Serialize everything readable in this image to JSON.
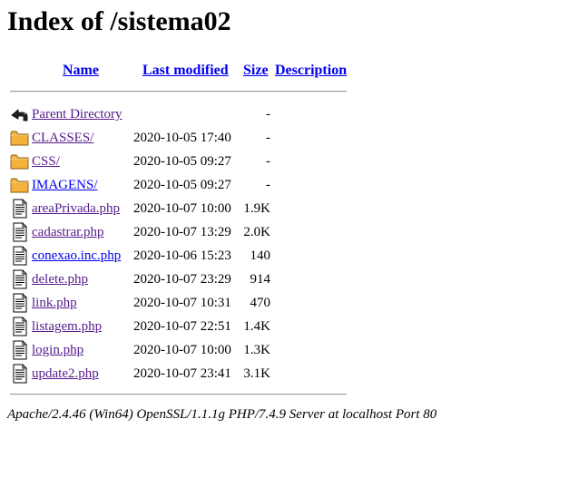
{
  "title": "Index of /sistema02",
  "columns": {
    "name": "Name",
    "last_modified": "Last modified",
    "size": "Size",
    "description": "Description"
  },
  "parent": {
    "label": "Parent Directory",
    "size": "-",
    "icon": "back-arrow-icon"
  },
  "entries": [
    {
      "name": "CLASSES/",
      "modified": "2020-10-05 17:40",
      "size": "-",
      "icon": "folder-icon",
      "visited": true
    },
    {
      "name": "CSS/",
      "modified": "2020-10-05 09:27",
      "size": "-",
      "icon": "folder-icon",
      "visited": true
    },
    {
      "name": "IMAGENS/",
      "modified": "2020-10-05 09:27",
      "size": "-",
      "icon": "folder-icon",
      "visited": false
    },
    {
      "name": "areaPrivada.php",
      "modified": "2020-10-07 10:00",
      "size": "1.9K",
      "icon": "file-icon",
      "visited": true
    },
    {
      "name": "cadastrar.php",
      "modified": "2020-10-07 13:29",
      "size": "2.0K",
      "icon": "file-icon",
      "visited": true
    },
    {
      "name": "conexao.inc.php",
      "modified": "2020-10-06 15:23",
      "size": "140",
      "icon": "file-icon",
      "visited": false
    },
    {
      "name": "delete.php",
      "modified": "2020-10-07 23:29",
      "size": "914",
      "icon": "file-icon",
      "visited": true
    },
    {
      "name": "link.php",
      "modified": "2020-10-07 10:31",
      "size": "470",
      "icon": "file-icon",
      "visited": true
    },
    {
      "name": "listagem.php",
      "modified": "2020-10-07 22:51",
      "size": "1.4K",
      "icon": "file-icon",
      "visited": true
    },
    {
      "name": "login.php",
      "modified": "2020-10-07 10:00",
      "size": "1.3K",
      "icon": "file-icon",
      "visited": true
    },
    {
      "name": "update2.php",
      "modified": "2020-10-07 23:41",
      "size": "3.1K",
      "icon": "file-icon",
      "visited": true
    }
  ],
  "address": "Apache/2.4.46 (Win64) OpenSSL/1.1.1g PHP/7.4.9 Server at localhost Port 80"
}
